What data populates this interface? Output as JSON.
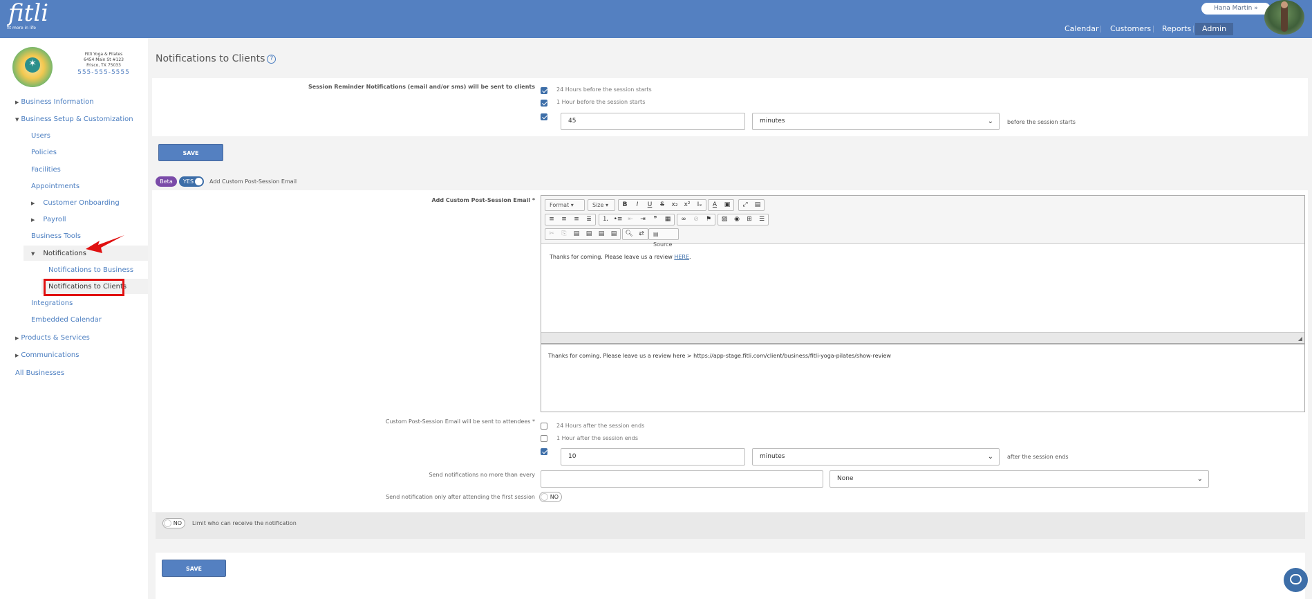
{
  "app": {
    "logo": "fitli",
    "tagline": "fit more in life"
  },
  "header": {
    "user_name": "Hana Martin",
    "user_caret": "»",
    "nav": [
      {
        "label": "Calendar"
      },
      {
        "label": "Customers"
      },
      {
        "label": "Reports"
      },
      {
        "label": "Admin",
        "active": true
      }
    ]
  },
  "business": {
    "name": "Fitli Yoga & Pilates",
    "address1": "6454 Main St #123",
    "address2": "Frisco, TX 75033",
    "phone": "555-555-5555"
  },
  "sidebar": {
    "business_information": "Business Information",
    "business_setup": "Business Setup & Customization",
    "users": "Users",
    "policies": "Policies",
    "facilities": "Facilities",
    "appointments": "Appointments",
    "customer_onboarding": "Customer Onboarding",
    "payroll": "Payroll",
    "business_tools": "Business Tools",
    "notifications": "Notifications",
    "notifications_business": "Notifications to Business",
    "notifications_clients": "Notifications to Clients",
    "integrations": "Integrations",
    "embedded_calendar": "Embedded Calendar",
    "products_services": "Products & Services",
    "communications": "Communications",
    "all_businesses": "All Businesses"
  },
  "page": {
    "title": "Notifications to Clients",
    "help": "?"
  },
  "reminder": {
    "label": "Session Reminder Notifications (email and/or sms) will be sent to clients",
    "opt1": "24 Hours before the session starts",
    "opt2": "1 Hour before the session starts",
    "custom_value": "45",
    "custom_unit": "minutes",
    "suffix": "before the session starts",
    "save": "SAVE"
  },
  "post_session": {
    "beta": "Beta",
    "toggle": "YES",
    "toggle_label": "Add Custom Post-Session Email",
    "email_label": "Add Custom Post-Session Email *",
    "toolbar": {
      "format": "Format",
      "size": "Size",
      "source": "Source"
    },
    "body_text": "Thanks for coming. Please leave us a review ",
    "body_link": "HERE",
    "body_end": ".",
    "plain_text": "Thanks for coming. Please leave us a review here > https://app-stage.fitli.com/client/business/fitli-yoga-pilates/show-review",
    "sent_label": "Custom Post-Session Email will be sent to attendees *",
    "opt1": "24 Hours after the session ends",
    "opt2": "1 Hour after the session ends",
    "custom_value": "10",
    "custom_unit": "minutes",
    "suffix": "after the session ends",
    "no_more_label": "Send notifications no more than every",
    "no_more_value": "",
    "no_more_unit": "None",
    "first_session_label": "Send notification only after attending the first session",
    "first_session_toggle": "NO",
    "limit_toggle": "NO",
    "limit_label": "Limit who can receive the notification",
    "save": "SAVE"
  }
}
